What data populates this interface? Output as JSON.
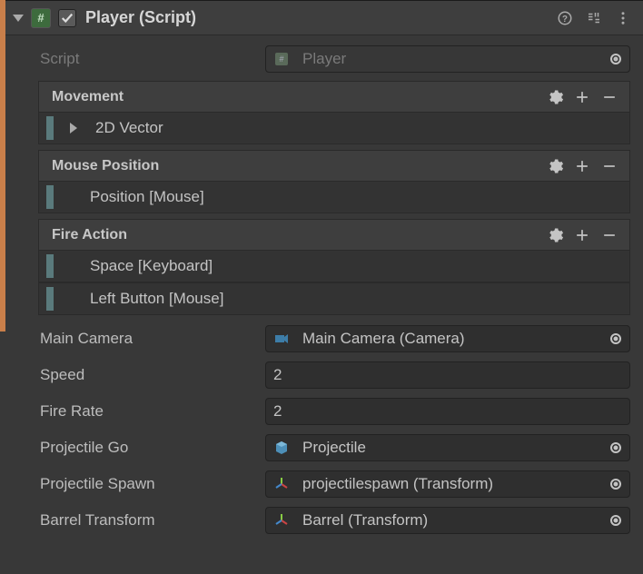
{
  "header": {
    "title": "Player (Script)",
    "enabled": true
  },
  "scriptRow": {
    "label": "Script",
    "value": "Player"
  },
  "inputActions": [
    {
      "name": "Movement",
      "bindings": [
        {
          "label": "2D Vector",
          "foldout": true
        }
      ]
    },
    {
      "name": "Mouse Position",
      "bindings": [
        {
          "label": "Position [Mouse]"
        }
      ]
    },
    {
      "name": "Fire Action",
      "bindings": [
        {
          "label": "Space [Keyboard]"
        },
        {
          "label": "Left Button [Mouse]"
        }
      ]
    }
  ],
  "fields": {
    "mainCamera": {
      "label": "Main Camera",
      "value": "Main Camera (Camera)",
      "icon": "camera"
    },
    "speed": {
      "label": "Speed",
      "value": "2"
    },
    "fireRate": {
      "label": "Fire Rate",
      "value": "2"
    },
    "projectileGo": {
      "label": "Projectile Go",
      "value": "Projectile",
      "icon": "prefab"
    },
    "projectileSpawn": {
      "label": "Projectile Spawn",
      "value": "projectilespawn (Transform)",
      "icon": "transform"
    },
    "barrelTransform": {
      "label": "Barrel Transform",
      "value": "Barrel (Transform)",
      "icon": "transform"
    }
  }
}
